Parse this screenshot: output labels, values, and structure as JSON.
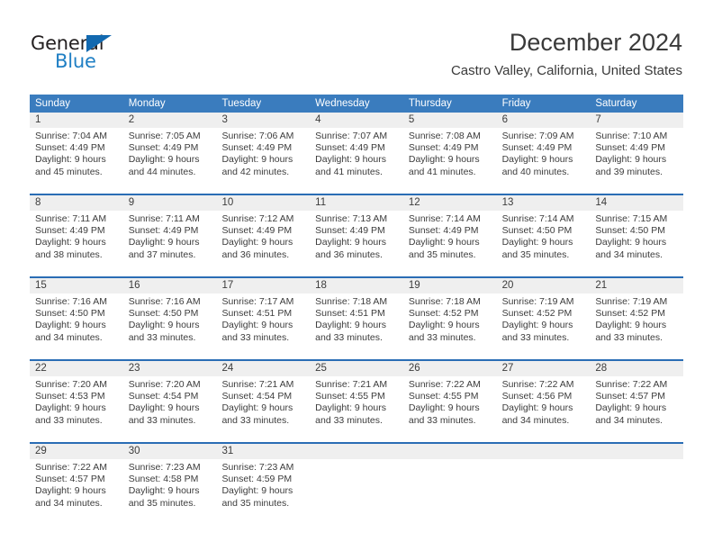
{
  "brand": {
    "name_part1": "General",
    "name_part2": "Blue",
    "triangle_color": "#1269b0",
    "blue_color": "#1f7fc4"
  },
  "header": {
    "title": "December 2024",
    "subtitle": "Castro Valley, California, United States"
  },
  "theme": {
    "header_blue": "#3a7cbe",
    "row_rule_blue": "#2a6db5",
    "daynum_band": "#efefef"
  },
  "weekdays": [
    "Sunday",
    "Monday",
    "Tuesday",
    "Wednesday",
    "Thursday",
    "Friday",
    "Saturday"
  ],
  "weeks": [
    {
      "days": [
        {
          "num": "1",
          "l1": "Sunrise: 7:04 AM",
          "l2": "Sunset: 4:49 PM",
          "l3": "Daylight: 9 hours",
          "l4": "and 45 minutes."
        },
        {
          "num": "2",
          "l1": "Sunrise: 7:05 AM",
          "l2": "Sunset: 4:49 PM",
          "l3": "Daylight: 9 hours",
          "l4": "and 44 minutes."
        },
        {
          "num": "3",
          "l1": "Sunrise: 7:06 AM",
          "l2": "Sunset: 4:49 PM",
          "l3": "Daylight: 9 hours",
          "l4": "and 42 minutes."
        },
        {
          "num": "4",
          "l1": "Sunrise: 7:07 AM",
          "l2": "Sunset: 4:49 PM",
          "l3": "Daylight: 9 hours",
          "l4": "and 41 minutes."
        },
        {
          "num": "5",
          "l1": "Sunrise: 7:08 AM",
          "l2": "Sunset: 4:49 PM",
          "l3": "Daylight: 9 hours",
          "l4": "and 41 minutes."
        },
        {
          "num": "6",
          "l1": "Sunrise: 7:09 AM",
          "l2": "Sunset: 4:49 PM",
          "l3": "Daylight: 9 hours",
          "l4": "and 40 minutes."
        },
        {
          "num": "7",
          "l1": "Sunrise: 7:10 AM",
          "l2": "Sunset: 4:49 PM",
          "l3": "Daylight: 9 hours",
          "l4": "and 39 minutes."
        }
      ]
    },
    {
      "days": [
        {
          "num": "8",
          "l1": "Sunrise: 7:11 AM",
          "l2": "Sunset: 4:49 PM",
          "l3": "Daylight: 9 hours",
          "l4": "and 38 minutes."
        },
        {
          "num": "9",
          "l1": "Sunrise: 7:11 AM",
          "l2": "Sunset: 4:49 PM",
          "l3": "Daylight: 9 hours",
          "l4": "and 37 minutes."
        },
        {
          "num": "10",
          "l1": "Sunrise: 7:12 AM",
          "l2": "Sunset: 4:49 PM",
          "l3": "Daylight: 9 hours",
          "l4": "and 36 minutes."
        },
        {
          "num": "11",
          "l1": "Sunrise: 7:13 AM",
          "l2": "Sunset: 4:49 PM",
          "l3": "Daylight: 9 hours",
          "l4": "and 36 minutes."
        },
        {
          "num": "12",
          "l1": "Sunrise: 7:14 AM",
          "l2": "Sunset: 4:49 PM",
          "l3": "Daylight: 9 hours",
          "l4": "and 35 minutes."
        },
        {
          "num": "13",
          "l1": "Sunrise: 7:14 AM",
          "l2": "Sunset: 4:50 PM",
          "l3": "Daylight: 9 hours",
          "l4": "and 35 minutes."
        },
        {
          "num": "14",
          "l1": "Sunrise: 7:15 AM",
          "l2": "Sunset: 4:50 PM",
          "l3": "Daylight: 9 hours",
          "l4": "and 34 minutes."
        }
      ]
    },
    {
      "days": [
        {
          "num": "15",
          "l1": "Sunrise: 7:16 AM",
          "l2": "Sunset: 4:50 PM",
          "l3": "Daylight: 9 hours",
          "l4": "and 34 minutes."
        },
        {
          "num": "16",
          "l1": "Sunrise: 7:16 AM",
          "l2": "Sunset: 4:50 PM",
          "l3": "Daylight: 9 hours",
          "l4": "and 33 minutes."
        },
        {
          "num": "17",
          "l1": "Sunrise: 7:17 AM",
          "l2": "Sunset: 4:51 PM",
          "l3": "Daylight: 9 hours",
          "l4": "and 33 minutes."
        },
        {
          "num": "18",
          "l1": "Sunrise: 7:18 AM",
          "l2": "Sunset: 4:51 PM",
          "l3": "Daylight: 9 hours",
          "l4": "and 33 minutes."
        },
        {
          "num": "19",
          "l1": "Sunrise: 7:18 AM",
          "l2": "Sunset: 4:52 PM",
          "l3": "Daylight: 9 hours",
          "l4": "and 33 minutes."
        },
        {
          "num": "20",
          "l1": "Sunrise: 7:19 AM",
          "l2": "Sunset: 4:52 PM",
          "l3": "Daylight: 9 hours",
          "l4": "and 33 minutes."
        },
        {
          "num": "21",
          "l1": "Sunrise: 7:19 AM",
          "l2": "Sunset: 4:52 PM",
          "l3": "Daylight: 9 hours",
          "l4": "and 33 minutes."
        }
      ]
    },
    {
      "days": [
        {
          "num": "22",
          "l1": "Sunrise: 7:20 AM",
          "l2": "Sunset: 4:53 PM",
          "l3": "Daylight: 9 hours",
          "l4": "and 33 minutes."
        },
        {
          "num": "23",
          "l1": "Sunrise: 7:20 AM",
          "l2": "Sunset: 4:54 PM",
          "l3": "Daylight: 9 hours",
          "l4": "and 33 minutes."
        },
        {
          "num": "24",
          "l1": "Sunrise: 7:21 AM",
          "l2": "Sunset: 4:54 PM",
          "l3": "Daylight: 9 hours",
          "l4": "and 33 minutes."
        },
        {
          "num": "25",
          "l1": "Sunrise: 7:21 AM",
          "l2": "Sunset: 4:55 PM",
          "l3": "Daylight: 9 hours",
          "l4": "and 33 minutes."
        },
        {
          "num": "26",
          "l1": "Sunrise: 7:22 AM",
          "l2": "Sunset: 4:55 PM",
          "l3": "Daylight: 9 hours",
          "l4": "and 33 minutes."
        },
        {
          "num": "27",
          "l1": "Sunrise: 7:22 AM",
          "l2": "Sunset: 4:56 PM",
          "l3": "Daylight: 9 hours",
          "l4": "and 34 minutes."
        },
        {
          "num": "28",
          "l1": "Sunrise: 7:22 AM",
          "l2": "Sunset: 4:57 PM",
          "l3": "Daylight: 9 hours",
          "l4": "and 34 minutes."
        }
      ]
    },
    {
      "days": [
        {
          "num": "29",
          "l1": "Sunrise: 7:22 AM",
          "l2": "Sunset: 4:57 PM",
          "l3": "Daylight: 9 hours",
          "l4": "and 34 minutes."
        },
        {
          "num": "30",
          "l1": "Sunrise: 7:23 AM",
          "l2": "Sunset: 4:58 PM",
          "l3": "Daylight: 9 hours",
          "l4": "and 35 minutes."
        },
        {
          "num": "31",
          "l1": "Sunrise: 7:23 AM",
          "l2": "Sunset: 4:59 PM",
          "l3": "Daylight: 9 hours",
          "l4": "and 35 minutes."
        },
        {
          "num": "",
          "l1": "",
          "l2": "",
          "l3": "",
          "l4": ""
        },
        {
          "num": "",
          "l1": "",
          "l2": "",
          "l3": "",
          "l4": ""
        },
        {
          "num": "",
          "l1": "",
          "l2": "",
          "l3": "",
          "l4": ""
        },
        {
          "num": "",
          "l1": "",
          "l2": "",
          "l3": "",
          "l4": ""
        }
      ]
    }
  ]
}
